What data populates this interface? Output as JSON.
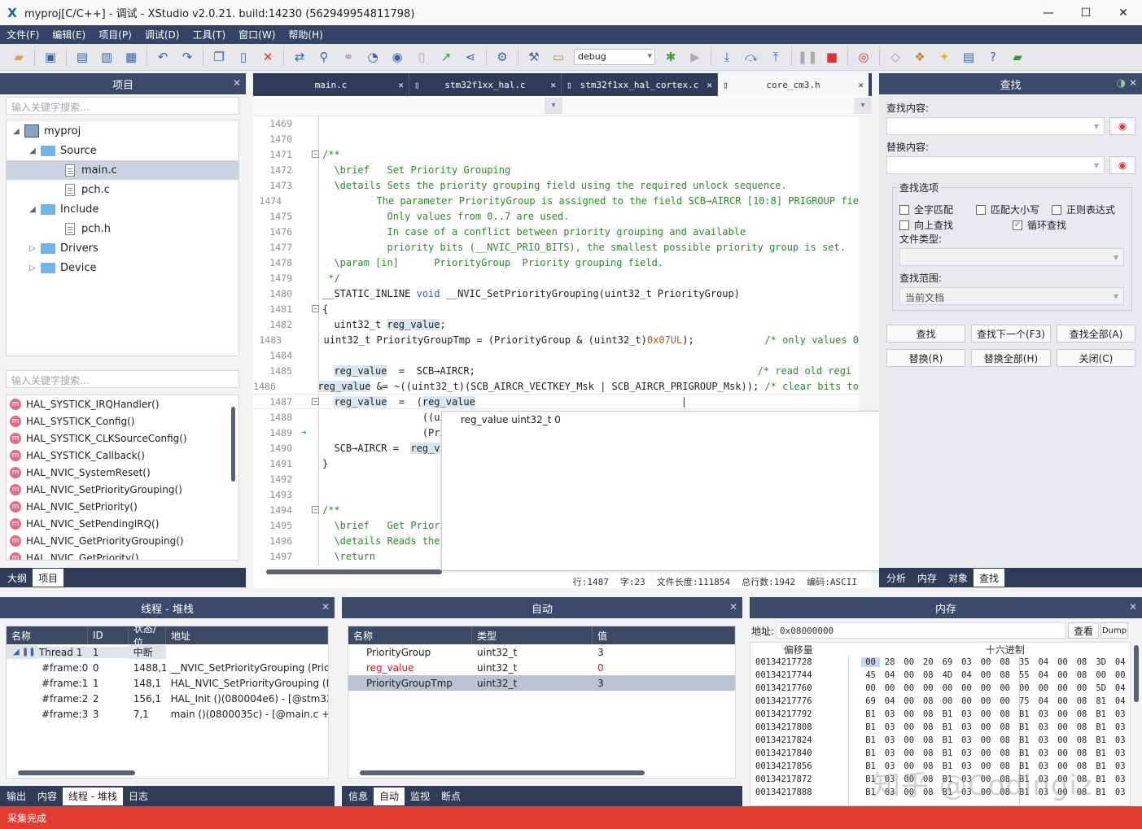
{
  "window": {
    "title": "myproj[C/C++] - 调试 - XStudio v2.0.21. build:14230 (562949954811798)",
    "logo": "X",
    "buttons": [
      "—",
      "☐",
      "✕"
    ]
  },
  "menu": [
    "文件(F)",
    "编辑(E)",
    "项目(P)",
    "调试(D)",
    "工具(T)",
    "窗口(W)",
    "帮助(H)"
  ],
  "toolbar": {
    "config": "debug"
  },
  "project_panel": {
    "title": "项目",
    "search_placeholder": "输入关键字搜索...",
    "tree": [
      {
        "label": "myproj",
        "level": 0,
        "type": "project",
        "fold": "◢"
      },
      {
        "label": "Source",
        "level": 1,
        "type": "folder",
        "fold": "◢"
      },
      {
        "label": "main.c",
        "level": 2,
        "type": "file",
        "selected": true
      },
      {
        "label": "pch.c",
        "level": 2,
        "type": "file"
      },
      {
        "label": "Include",
        "level": 1,
        "type": "folder",
        "fold": "◢"
      },
      {
        "label": "pch.h",
        "level": 2,
        "type": "file"
      },
      {
        "label": "Drivers",
        "level": 1,
        "type": "folder",
        "fold": "▷"
      },
      {
        "label": "Device",
        "level": 1,
        "type": "folder",
        "fold": "▷"
      }
    ]
  },
  "symbols_panel": {
    "search_placeholder": "输入关键字搜索...",
    "items": [
      "HAL_SYSTICK_IRQHandler()",
      "HAL_SYSTICK_Config()",
      "HAL_SYSTICK_CLKSourceConfig()",
      "HAL_SYSTICK_Callback()",
      "HAL_NVIC_SystemReset()",
      "HAL_NVIC_SetPriorityGrouping()",
      "HAL_NVIC_SetPriority()",
      "HAL_NVIC_SetPendingIRQ()",
      "HAL_NVIC_GetPriorityGrouping()",
      "HAL_NVIC_GetPriority()"
    ],
    "icon_letter": "m",
    "tabs": [
      "大纲",
      "项目"
    ]
  },
  "editor": {
    "tabs": [
      {
        "label": "main.c"
      },
      {
        "label": "stm32f1xx_hal.c"
      },
      {
        "label": "stm32f1xx_hal_cortex.c"
      },
      {
        "label": "core_cm3.h",
        "selected": true
      }
    ],
    "lines": [
      {
        "n": "1469",
        "html": ""
      },
      {
        "n": "1470",
        "html": ""
      },
      {
        "n": "1471",
        "html": "<span class='c'>/**</span>",
        "fold": "−"
      },
      {
        "n": "1472",
        "html": "<span class='c'>  \\brief   Set Priority Grouping</span>"
      },
      {
        "n": "1473",
        "html": "<span class='c'>  \\details Sets the priority grouping field using the required unlock sequence.</span>"
      },
      {
        "n": "1474",
        "html": "<span class='c'>           The parameter PriorityGroup is assigned to the field SCB→AIRCR [10:8] PRIGROUP fie</span>"
      },
      {
        "n": "1475",
        "html": "<span class='c'>           Only values from 0..7 are used.</span>"
      },
      {
        "n": "1476",
        "html": "<span class='c'>           In case of a conflict between priority grouping and available</span>"
      },
      {
        "n": "1477",
        "html": "<span class='c'>           priority bits (__NVIC_PRIO_BITS), the smallest possible priority group is set.</span>"
      },
      {
        "n": "1478",
        "html": "<span class='c'>  \\param [in]      PriorityGroup  Priority grouping field.</span>"
      },
      {
        "n": "1479",
        "html": "<span class='c'> */</span>"
      },
      {
        "n": "1480",
        "html": "__STATIC_INLINE <span class='k'>void</span> __NVIC_SetPriorityGrouping(uint32_t PriorityGroup)"
      },
      {
        "n": "1481",
        "html": "{",
        "fold": "−"
      },
      {
        "n": "1482",
        "html": "  uint32_t <span class='hl'>reg_value</span>;"
      },
      {
        "n": "1483",
        "html": "  uint32_t PriorityGroupTmp = (PriorityGroup &amp; (uint32_t)<span class='n'>0x07UL</span>);            <span class='c'>/* only values 0</span>"
      },
      {
        "n": "1484",
        "html": ""
      },
      {
        "n": "1485",
        "html": "  <span class='hl'>reg_value</span>  =  SCB→AIRCR;                                                <span class='c'>/* read old regi</span>"
      },
      {
        "n": "1486",
        "html": "  <span class='hl'>reg_value</span> &amp;= ~((uint32_t)(SCB_AIRCR_VECTKEY_Msk | SCB_AIRCR_PRIGROUP_Msk)); <span class='c'>/* clear bits to</span>"
      },
      {
        "n": "1487",
        "html": "  <span class='hl'>reg_value</span>  =  (<span class='hl'>reg_value</span>                                   |",
        "fold": "−"
      },
      {
        "n": "1488",
        "html": "                 ((uin"
      },
      {
        "n": "1489",
        "html": "                 (Prio",
        "arrow": true
      },
      {
        "n": "1490",
        "html": "  SCB→AIRCR =  <span class='hl'>reg_v</span>"
      },
      {
        "n": "1491",
        "html": "}"
      },
      {
        "n": "1492",
        "html": ""
      },
      {
        "n": "1493",
        "html": ""
      },
      {
        "n": "1494",
        "html": "<span class='c'>/**</span>",
        "fold": "−"
      },
      {
        "n": "1495",
        "html": "<span class='c'>  \\brief   Get Priori</span>"
      },
      {
        "n": "1496",
        "html": "<span class='c'>  \\details Reads the </span>"
      },
      {
        "n": "1497",
        "html": "<span class='c'>  \\return</span>"
      }
    ],
    "tooltip": "reg_value uint32_t 0",
    "status": {
      "line": "行:1487",
      "col": "字:23",
      "len": "文件长度:111854",
      "total": "总行数:1942",
      "enc": "编码:ASCII"
    }
  },
  "find_panel": {
    "title": "查找",
    "find_label": "查找内容:",
    "replace_label": "替换内容:",
    "options_title": "查找选项",
    "options": [
      {
        "label": "全字匹配",
        "checked": false
      },
      {
        "label": "匹配大小写",
        "checked": false
      },
      {
        "label": "正则表达式",
        "checked": false
      },
      {
        "label": "向上查找",
        "checked": false
      },
      {
        "label": "循环查找",
        "checked": true
      }
    ],
    "filetype_label": "文件类型:",
    "scope_label": "查找范围:",
    "scope_value": "当前文档",
    "buttons": [
      "查找",
      "查找下一个(F3)",
      "查找全部(A)",
      "替换(R)",
      "替换全部(H)",
      "关闭(C)"
    ],
    "tabs": [
      "分析",
      "内存",
      "对象",
      "查找"
    ]
  },
  "threads_panel": {
    "title": "线程 - 堆栈",
    "columns": [
      "名称",
      "ID",
      "状态/位",
      "地址"
    ],
    "rows": [
      [
        "Thread 1",
        "1",
        "中断",
        ""
      ],
      [
        "#frame:0",
        "0",
        "1488,1",
        "__NVIC_SetPriorityGrouping (Prior"
      ],
      [
        "#frame:1",
        "1",
        "148,1",
        "HAL_NVIC_SetPriorityGrouping (P"
      ],
      [
        "#frame:2",
        "2",
        "156,1",
        "HAL_Init ()(080004e6)  -  [@stm32"
      ],
      [
        "#frame:3",
        "3",
        "7,1",
        "main ()(0800035c)  -  [@main.c +"
      ]
    ],
    "tabs": [
      "输出",
      "内容",
      "线程 - 堆栈",
      "日志"
    ]
  },
  "auto_panel": {
    "title": "自动",
    "columns": [
      "名称",
      "类型",
      "值"
    ],
    "rows": [
      {
        "name": "PriorityGroup",
        "type": "uint32_t",
        "value": "3",
        "changed": false
      },
      {
        "name": "reg_value",
        "type": "uint32_t",
        "value": "0",
        "changed": true
      },
      {
        "name": "PriorityGroupTmp",
        "type": "uint32_t",
        "value": "3",
        "changed": false,
        "selected": true
      }
    ],
    "tabs": [
      "信息",
      "自动",
      "监视",
      "断点"
    ]
  },
  "memory_panel": {
    "title": "内存",
    "addr_label": "地址:",
    "addr_value": "0x08000000",
    "view_btn": "查看",
    "dump_btn": "Dump",
    "offset_header": "偏移量",
    "hex_header": "十六进制",
    "rows": [
      {
        "addr": "00134217728",
        "bytes": [
          "00",
          "28",
          "00",
          "20",
          "69",
          "03",
          "00",
          "08",
          "35",
          "04",
          "00",
          "08",
          "3D",
          "04"
        ]
      },
      {
        "addr": "00134217744",
        "bytes": [
          "45",
          "04",
          "00",
          "08",
          "4D",
          "04",
          "00",
          "08",
          "55",
          "04",
          "00",
          "08",
          "00",
          "00"
        ]
      },
      {
        "addr": "00134217760",
        "bytes": [
          "00",
          "00",
          "00",
          "00",
          "00",
          "00",
          "00",
          "00",
          "00",
          "00",
          "00",
          "00",
          "5D",
          "04"
        ]
      },
      {
        "addr": "00134217776",
        "bytes": [
          "69",
          "04",
          "00",
          "08",
          "00",
          "00",
          "00",
          "00",
          "75",
          "04",
          "00",
          "08",
          "81",
          "04"
        ]
      },
      {
        "addr": "00134217792",
        "bytes": [
          "B1",
          "03",
          "00",
          "08",
          "B1",
          "03",
          "00",
          "08",
          "B1",
          "03",
          "00",
          "08",
          "B1",
          "03"
        ]
      },
      {
        "addr": "00134217808",
        "bytes": [
          "B1",
          "03",
          "00",
          "08",
          "B1",
          "03",
          "00",
          "08",
          "B1",
          "03",
          "00",
          "08",
          "B1",
          "03"
        ]
      },
      {
        "addr": "00134217824",
        "bytes": [
          "B1",
          "03",
          "00",
          "08",
          "B1",
          "03",
          "00",
          "08",
          "B1",
          "03",
          "00",
          "08",
          "B1",
          "03"
        ]
      },
      {
        "addr": "00134217840",
        "bytes": [
          "B1",
          "03",
          "00",
          "08",
          "B1",
          "03",
          "00",
          "08",
          "B1",
          "03",
          "00",
          "08",
          "B1",
          "03"
        ]
      },
      {
        "addr": "00134217856",
        "bytes": [
          "B1",
          "03",
          "00",
          "08",
          "B1",
          "03",
          "00",
          "08",
          "B1",
          "03",
          "00",
          "08",
          "B1",
          "03"
        ]
      },
      {
        "addr": "00134217872",
        "bytes": [
          "B1",
          "03",
          "00",
          "08",
          "B1",
          "03",
          "00",
          "08",
          "B1",
          "03",
          "00",
          "08",
          "B1",
          "03"
        ]
      },
      {
        "addr": "00134217888",
        "bytes": [
          "B1",
          "03",
          "00",
          "08",
          "B1",
          "03",
          "00",
          "08",
          "B1",
          "03",
          "00",
          "08",
          "B1",
          "03"
        ]
      }
    ],
    "watermark": "知乎 @Codingiz"
  },
  "statusbar": {
    "text": "采集完成"
  },
  "colors": {
    "accent": "#334466",
    "status": "#e33b2e",
    "highlight": "#d8e6f2"
  }
}
